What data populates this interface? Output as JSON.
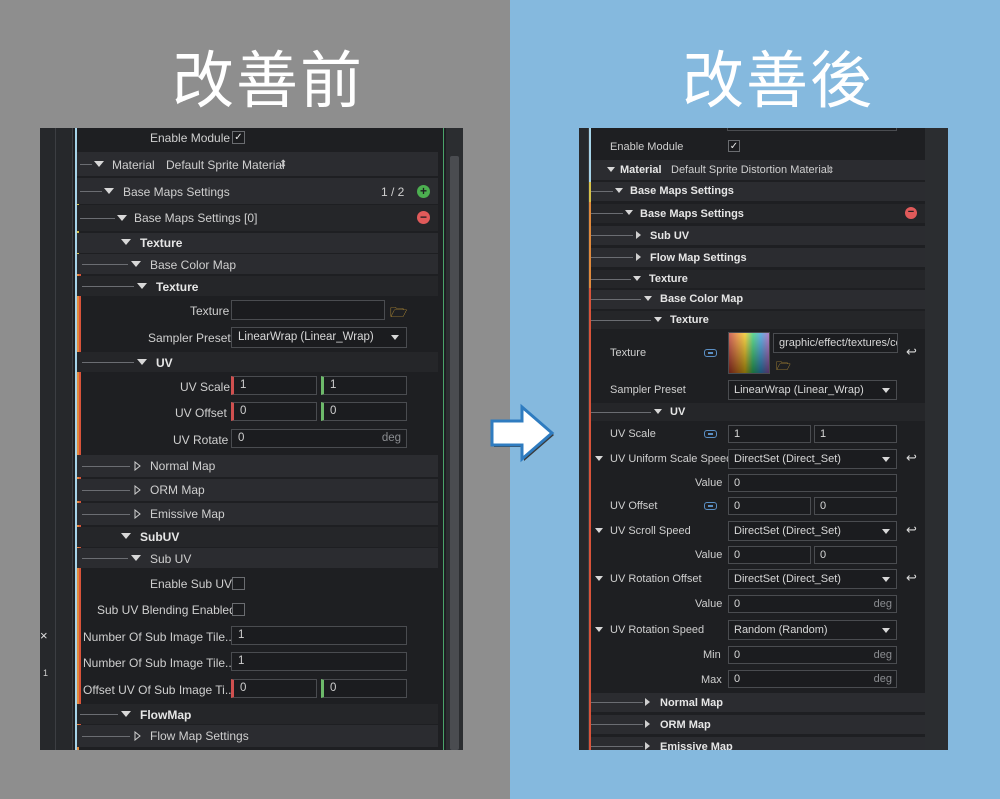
{
  "titles": {
    "before": "改善前",
    "after": "改善後"
  },
  "colors": {
    "left_bg": "#8e8e8e",
    "right_bg": "#85b9de",
    "panel_bg": "#1e1f22",
    "accent_red": "#d0504f",
    "accent_green": "#6dba6a",
    "add_green": "#4caf50",
    "remove_red": "#e05a5a"
  },
  "left": {
    "enable_module": "Enable Module",
    "material_label": "Material",
    "material_value": "Default Sprite Material",
    "base_maps_settings": "Base Maps Settings",
    "count": "1 / 2",
    "base_maps_item": "Base Maps Settings [0]",
    "texture_header": "Texture",
    "base_color_map": "Base Color Map",
    "texture_sub": "Texture",
    "texture_label": "Texture",
    "sampler_label": "Sampler Preset",
    "sampler_value": "LinearWrap  (Linear_Wrap)",
    "uv_header": "UV",
    "uv_scale": "UV Scale",
    "uv_scale_x": "1",
    "uv_scale_y": "1",
    "uv_offset": "UV Offset",
    "uv_offset_x": "0",
    "uv_offset_y": "0",
    "uv_rotate": "UV Rotate",
    "uv_rotate_v": "0",
    "deg": "deg",
    "normal_map": "Normal Map",
    "orm_map": "ORM Map",
    "emissive_map": "Emissive Map",
    "subuv_header": "SubUV",
    "sub_uv": "Sub UV",
    "enable_sub_uv": "Enable Sub UV",
    "sub_uv_blending": "Sub UV Blending Enabled",
    "num_sub_1": "Number Of Sub Image Tile...",
    "num_sub_1_v": "1",
    "num_sub_2": "Number Of Sub Image Tile...",
    "num_sub_2_v": "1",
    "offset_uv": "Offset UV Of Sub Image Ti...",
    "offset_uv_x": "0",
    "offset_uv_y": "0",
    "flowmap_header": "FlowMap",
    "flow_map_settings": "Flow Map Settings",
    "edge_x": "×",
    "edge_one": "1"
  },
  "right": {
    "enable_module": "Enable Module",
    "material_label": "Material",
    "material_value": "Default Sprite Distortion Material",
    "base_maps_settings": "Base Maps Settings",
    "base_maps_inner": "Base Maps Settings",
    "sub_uv": "Sub UV",
    "flow_map_settings": "Flow Map Settings",
    "texture_header": "Texture",
    "base_color_map": "Base Color Map",
    "texture_sub": "Texture",
    "texture_label": "Texture",
    "texture_path": "graphic/effect/textures/colo",
    "sampler_label": "Sampler Preset",
    "sampler_value": "LinearWrap  (Linear_Wrap)",
    "uv_header": "UV",
    "uv_scale": "UV Scale",
    "uv_scale_x": "1",
    "uv_scale_y": "1",
    "uv_uniform": "UV Uniform Scale Speed",
    "uv_uniform_sel": "DirectSet  (Direct_Set)",
    "value_label": "Value",
    "uv_uniform_v": "0",
    "uv_offset": "UV Offset",
    "uv_offset_x": "0",
    "uv_offset_y": "0",
    "uv_scroll": "UV Scroll Speed",
    "uv_scroll_sel": "DirectSet  (Direct_Set)",
    "uv_scroll_x": "0",
    "uv_scroll_y": "0",
    "uv_rot_offset": "UV Rotation Offset",
    "uv_rot_offset_sel": "DirectSet  (Direct_Set)",
    "uv_rot_offset_v": "0",
    "uv_rot_speed": "UV Rotation Speed",
    "uv_rot_speed_sel": "Random  (Random)",
    "min_label": "Min",
    "min_v": "0",
    "max_label": "Max",
    "max_v": "0",
    "deg": "deg",
    "normal_map": "Normal Map",
    "orm_map": "ORM Map",
    "emissive_map": "Emissive Map"
  }
}
